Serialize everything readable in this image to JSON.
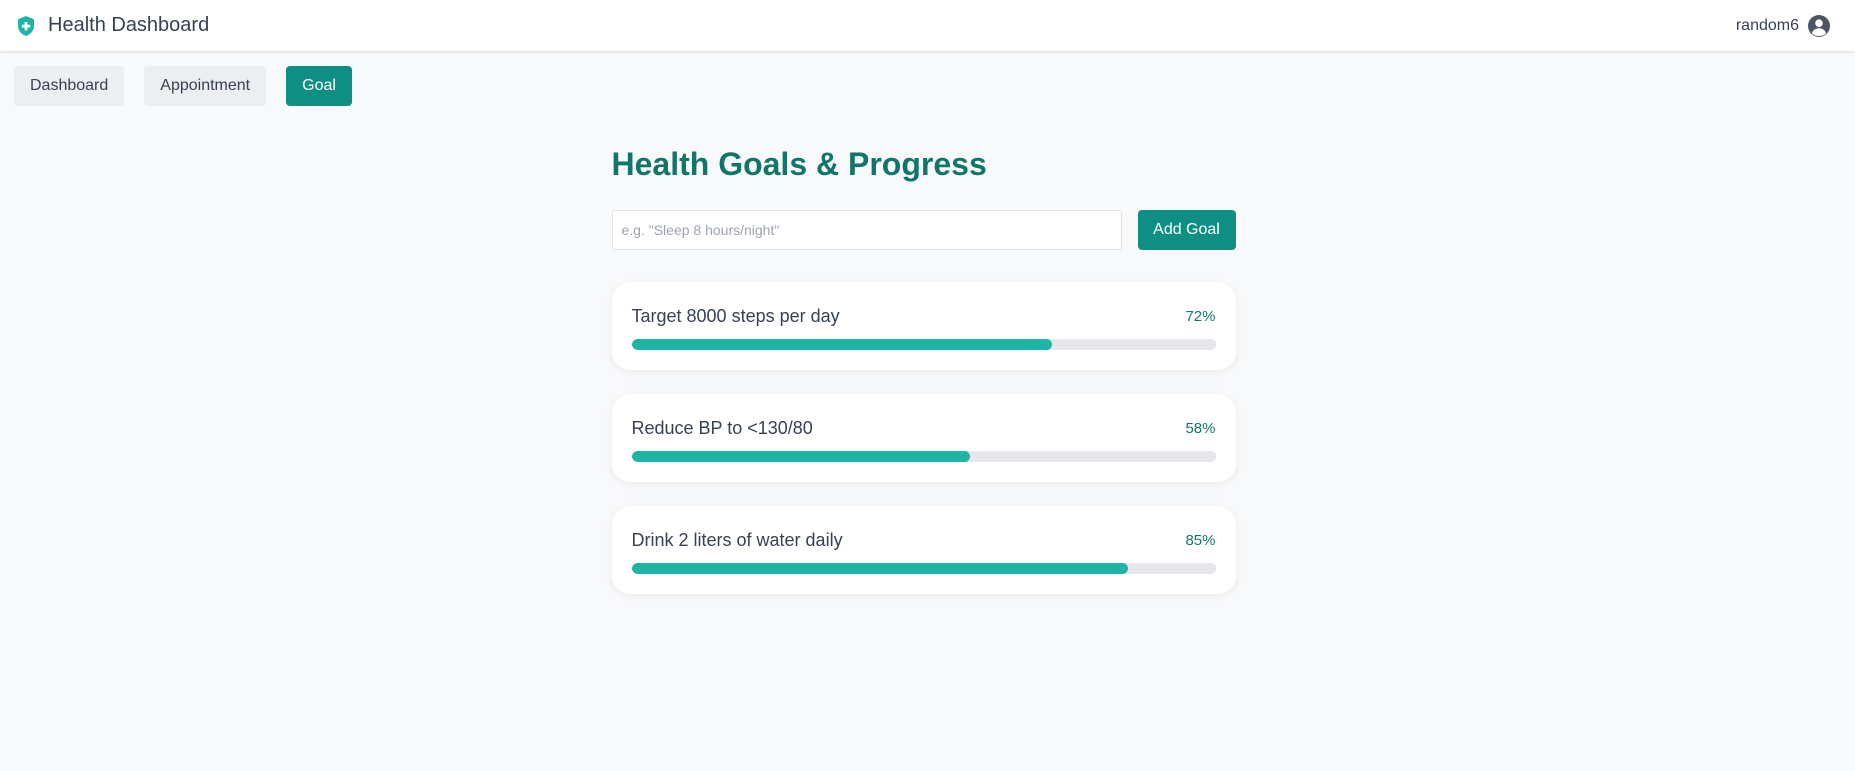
{
  "header": {
    "title": "Health Dashboard",
    "brand_icon": "shield-plus-icon",
    "username": "random6",
    "avatar_icon": "user-circle-icon"
  },
  "nav": {
    "tabs": [
      {
        "label": "Dashboard",
        "active": false
      },
      {
        "label": "Appointment",
        "active": false
      },
      {
        "label": "Goal",
        "active": true
      }
    ]
  },
  "main": {
    "title": "Health Goals & Progress",
    "input_placeholder": "e.g. \"Sleep 8 hours/night\"",
    "input_value": "",
    "add_button_label": "Add Goal",
    "goals": [
      {
        "label": "Target 8000 steps per day",
        "percent_text": "72%",
        "percent": 72
      },
      {
        "label": "Reduce BP to <130/80",
        "percent_text": "58%",
        "percent": 58
      },
      {
        "label": "Drink 2 liters of water daily",
        "percent_text": "85%",
        "percent": 85
      }
    ]
  },
  "colors": {
    "accent": "#0f8f84",
    "title": "#11756b",
    "progress": "#1fb5a5",
    "track": "#e5e7eb"
  }
}
